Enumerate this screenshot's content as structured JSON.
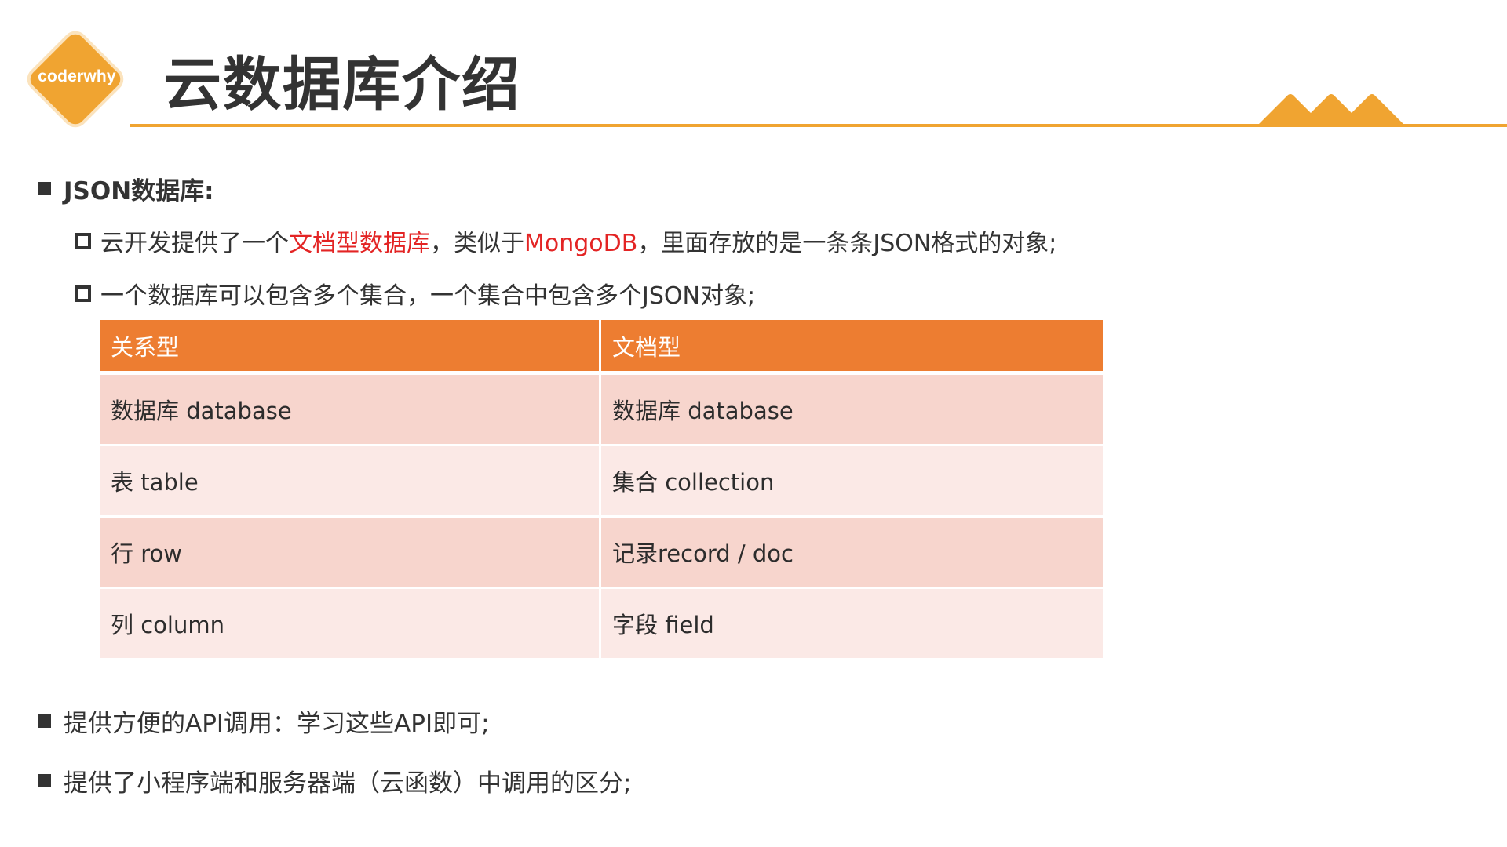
{
  "logo": {
    "text": "coderwhy"
  },
  "title": "云数据库介绍",
  "colors": {
    "accent": "#f0a431",
    "table_header": "#ed7d31",
    "row_dark": "#f7d5cd",
    "row_light": "#fbe9e6",
    "highlight": "#e32424"
  },
  "section1": {
    "heading": "JSON数据库:",
    "item1": {
      "part1": "云开发提供了一个",
      "highlight1": "文档型数据库",
      "part2": "，类似于",
      "highlight2": "MongoDB",
      "part3": "，里面存放的是一条条JSON格式的对象;"
    },
    "item2": "一个数据库可以包含多个集合，一个集合中包含多个JSON对象;"
  },
  "table": {
    "headers": [
      "关系型",
      "文档型"
    ],
    "rows": [
      [
        "数据库 database",
        "数据库 database"
      ],
      [
        "表 table",
        "集合 collection"
      ],
      [
        "行 row",
        "记录record / doc"
      ],
      [
        "列 column",
        "字段 field"
      ]
    ]
  },
  "section2": "提供方便的API调用：学习这些API即可;",
  "section3": "提供了小程序端和服务器端（云函数）中调用的区分;"
}
